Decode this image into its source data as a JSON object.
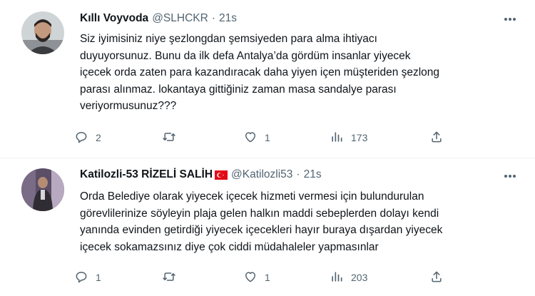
{
  "tweets": [
    {
      "author_name": "Kıllı Voyvoda",
      "handle": "@SLHCKR",
      "separator": "·",
      "time": "21s",
      "lines": [
        "Siz iyimisiniz niye şezlongdan şemsiyeden para alma ihtiyacı",
        "duyuyorsunuz. Bunu da ilk defa Antalya’da gördüm insanlar yiyecek",
        "içecek orda zaten para kazandıracak daha yiyen içen müşteriden şezlong",
        "parası alınmaz. lokantaya gittiğiniz zaman masa sandalye parası",
        "veriyormusunuz???"
      ],
      "replies": "2",
      "retweets": "",
      "likes": "1",
      "views": "173"
    },
    {
      "author_name": "Katilozli-53 RİZELİ SALİH",
      "handle": "@Katilozli53",
      "separator": "·",
      "time": "21s",
      "lines": [
        "Orda Belediye olarak yiyecek içecek hizmeti vermesi için bulundurulan",
        "görevlilerinize söyleyin plaja gelen halkın maddi sebeplerden dolayı kendi",
        "yanında evinden getirdiği yiyecek içecekleri hayır buraya dışardan yiyecek",
        "içecek sokamazsınız diye çok ciddi müdahaleler yapmasınlar"
      ],
      "replies": "1",
      "retweets": "",
      "likes": "1",
      "views": "203"
    }
  ],
  "icons": {
    "reply": "reply-icon",
    "retweet": "retweet-icon",
    "like": "heart-icon",
    "views": "views-icon",
    "share": "share-icon",
    "more": "more-icon",
    "flag": "turkey-flag-icon"
  },
  "colors": {
    "text": "#0f1419",
    "secondary": "#536471",
    "divider": "#eff3f4",
    "flag": "#e30a17"
  }
}
